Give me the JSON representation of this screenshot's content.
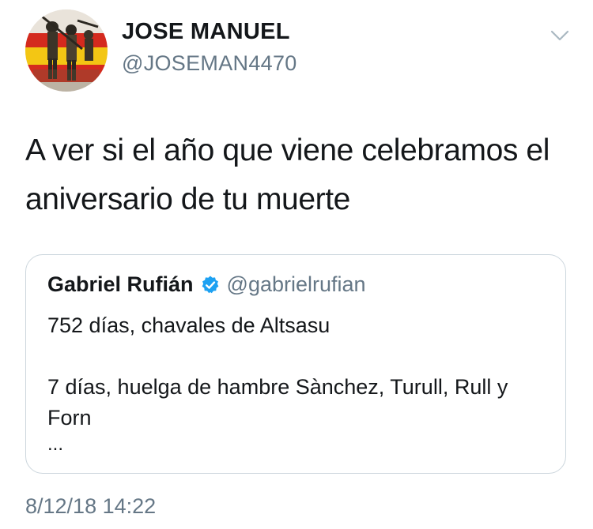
{
  "author": {
    "display_name": "JOSE MANUEL",
    "handle": "@JOSEMAN4470",
    "avatar_icon": "profile-avatar-image"
  },
  "menu_icon": "chevron-down-icon",
  "tweet": {
    "text": "A ver si el año que viene celebramos el aniversario de tu muerte",
    "timestamp": "8/12/18 14:22"
  },
  "quoted_tweet": {
    "display_name": "Gabriel Rufián",
    "verified_icon": "verified-badge-icon",
    "handle": "@gabrielrufian",
    "text": "752 días, chavales de Altsasu\n\n7 días, huelga de hambre Sànchez, Turull, Rull y Forn",
    "ellipsis": "..."
  },
  "colors": {
    "primary_text": "#14171a",
    "secondary_text": "#657786",
    "border": "#ccd6dd",
    "verified_blue": "#1da1f2"
  }
}
